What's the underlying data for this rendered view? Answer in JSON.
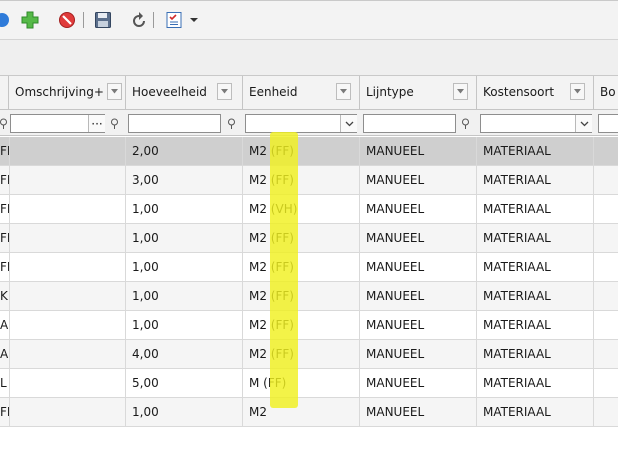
{
  "colors": {
    "highlight": "#f0f020",
    "selected_row": "#cfcfcf",
    "alt_row": "#f5f5f5"
  },
  "toolbar": {
    "icons": [
      "refresh-icon",
      "add-icon",
      "cancel-icon",
      "save-icon",
      "undo-icon",
      "checklist-icon",
      "dropdown-arrow-icon"
    ]
  },
  "grid": {
    "columns": [
      {
        "label": ""
      },
      {
        "label": "Omschrijving+"
      },
      {
        "label": "Hoeveelheid"
      },
      {
        "label": "Eenheid"
      },
      {
        "label": "Lijntype"
      },
      {
        "label": "Kostensoort"
      },
      {
        "label": "Bo"
      }
    ],
    "rows": [
      {
        "c0": "FI",
        "c1": "",
        "c2": "2,00",
        "c3": "M2 (FF)",
        "c4": "MANUEEL",
        "c5": "MATERIAAL"
      },
      {
        "c0": "FI",
        "c1": "",
        "c2": "3,00",
        "c3": "M2 (FF)",
        "c4": "MANUEEL",
        "c5": "MATERIAAL"
      },
      {
        "c0": "FI",
        "c1": "",
        "c2": "1,00",
        "c3": "M2 (VH)",
        "c4": "MANUEEL",
        "c5": "MATERIAAL"
      },
      {
        "c0": "FI",
        "c1": "",
        "c2": "1,00",
        "c3": "M2 (FF)",
        "c4": "MANUEEL",
        "c5": "MATERIAAL"
      },
      {
        "c0": "FI",
        "c1": "",
        "c2": "1,00",
        "c3": "M2 (FF)",
        "c4": "MANUEEL",
        "c5": "MATERIAAL"
      },
      {
        "c0": "KI",
        "c1": "",
        "c2": "1,00",
        "c3": "M2 (FF)",
        "c4": "MANUEEL",
        "c5": "MATERIAAL"
      },
      {
        "c0": "A",
        "c1": "",
        "c2": "1,00",
        "c3": "M2 (FF)",
        "c4": "MANUEEL",
        "c5": "MATERIAAL"
      },
      {
        "c0": "A",
        "c1": "",
        "c2": "4,00",
        "c3": "M2 (FF)",
        "c4": "MANUEEL",
        "c5": "MATERIAAL"
      },
      {
        "c0": "L",
        "c1": "",
        "c2": "5,00",
        "c3": "M (FF)",
        "c4": "MANUEEL",
        "c5": "MATERIAAL"
      },
      {
        "c0": "FI",
        "c1": "",
        "c2": "1,00",
        "c3": "M2",
        "c4": "MANUEEL",
        "c5": "MATERIAAL"
      }
    ],
    "filter_button_label": "···"
  }
}
